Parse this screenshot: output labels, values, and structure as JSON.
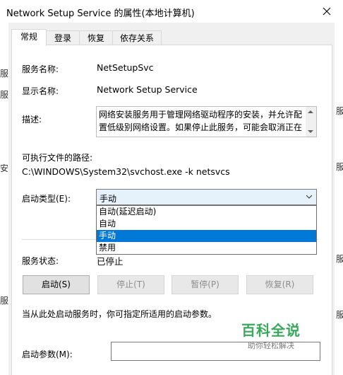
{
  "window": {
    "title": "Network Setup Service 的属性(本地计算机)"
  },
  "tabs": [
    {
      "label": "常规",
      "active": true
    },
    {
      "label": "登录",
      "active": false
    },
    {
      "label": "恢复",
      "active": false
    },
    {
      "label": "依存关系",
      "active": false
    }
  ],
  "general": {
    "service_name_label": "服务名称:",
    "service_name": "NetSetupSvc",
    "display_name_label": "显示名称:",
    "display_name": "Network Setup Service",
    "description_label": "描述:",
    "description": "网络安装服务用于管理网络驱动程序的安装，并允许配置低级别网络设置。如果停止此服务，可能会取消正在",
    "exe_path_label": "可执行文件的路径:",
    "exe_path": "C:\\WINDOWS\\System32\\svchost.exe -k netsvcs",
    "startup_type_label": "启动类型(E):",
    "startup_type_value": "手动",
    "startup_options": [
      "自动(延迟启动)",
      "自动",
      "手动",
      "禁用"
    ],
    "startup_selected_index": 2,
    "service_status_label": "服务状态:",
    "service_status": "已停止",
    "buttons": {
      "start": "启动(S)",
      "stop": "停止(T)",
      "pause": "暂停(P)",
      "resume": "恢复(R)"
    },
    "start_params_hint": "当从此处启动服务时，你可指定所适用的启动参数。",
    "start_params_label": "启动参数(M):",
    "start_params_value": ""
  },
  "background": {
    "left_chars": [
      "服",
      "服",
      "安",
      "服"
    ],
    "right_chars": [
      "服",
      "服",
      "服",
      "服"
    ]
  },
  "watermark": {
    "title": "百科全说",
    "subtitle": "助你轻松解决"
  },
  "colors": {
    "selection": "#0078d7",
    "watermark": "#3aa85c"
  }
}
